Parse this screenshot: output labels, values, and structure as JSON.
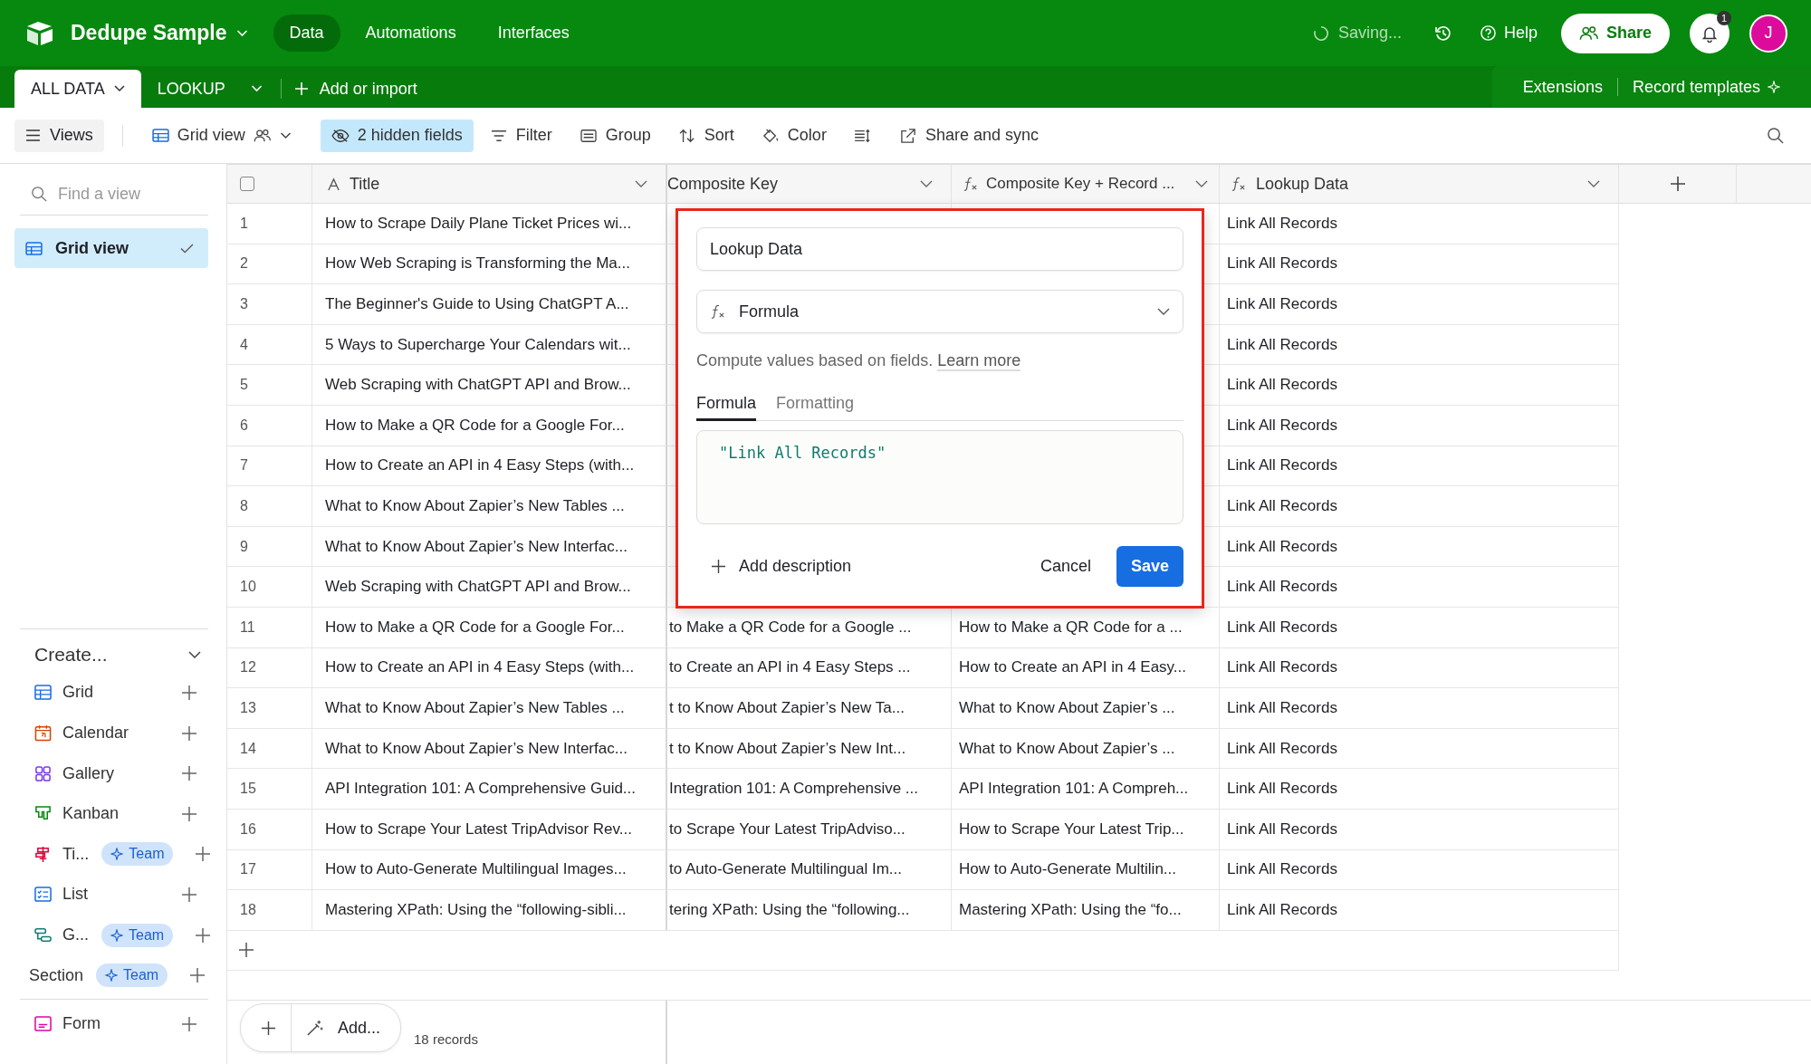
{
  "header": {
    "base_name": "Dedupe Sample",
    "nav": [
      {
        "label": "Data",
        "selected": true
      },
      {
        "label": "Automations",
        "selected": false
      },
      {
        "label": "Interfaces",
        "selected": false
      }
    ],
    "status": "Saving...",
    "help": "Help",
    "share": "Share",
    "notification_count": "1",
    "avatar": "J"
  },
  "table_tabs": [
    {
      "label": "ALL DATA",
      "selected": true
    },
    {
      "label": "LOOKUP",
      "selected": false
    }
  ],
  "add_or_import": "Add or import",
  "extensions": "Extensions",
  "record_templates": "Record templates",
  "toolbar": {
    "views": "Views",
    "view_name": "Grid view",
    "items": [
      {
        "kind": "hidden",
        "label": "2 hidden fields",
        "highlighted": true
      },
      {
        "kind": "filter",
        "label": "Filter",
        "highlighted": false
      },
      {
        "kind": "group",
        "label": "Group",
        "highlighted": false
      },
      {
        "kind": "sort",
        "label": "Sort",
        "highlighted": false
      },
      {
        "kind": "color",
        "label": "Color",
        "highlighted": false
      },
      {
        "kind": "row_height",
        "highlighted": false
      },
      {
        "kind": "share",
        "label": "Share and sync",
        "highlighted": false
      }
    ]
  },
  "sidebar": {
    "search_placeholder": "Find a view",
    "views": [
      {
        "label": "Grid view",
        "selected": true
      }
    ],
    "create_title": "Create...",
    "create_items": [
      {
        "kind": "grid",
        "label": "Grid"
      },
      {
        "kind": "calendar",
        "label": "Calendar"
      },
      {
        "kind": "gallery",
        "label": "Gallery"
      },
      {
        "kind": "kanban",
        "label": "Kanban"
      },
      {
        "kind": "timeline",
        "label": "Ti...",
        "badge": "Team"
      },
      {
        "kind": "list",
        "label": "List"
      },
      {
        "kind": "gantt",
        "label": "G...",
        "badge": "Team"
      },
      {
        "kind": "section",
        "label": "Section",
        "badge": "Team"
      }
    ],
    "bottom_items": [
      {
        "kind": "form",
        "label": "Form"
      }
    ]
  },
  "table": {
    "select_all_checked": false,
    "columns": [
      {
        "kind": "text",
        "label": "Title"
      },
      {
        "kind": "hidden_icon",
        "label": "Composite Key"
      },
      {
        "kind": "formula",
        "label": "Composite Key + Record ..."
      },
      {
        "kind": "formula",
        "label": "Lookup Data"
      }
    ],
    "rows": [
      {
        "number": "1",
        "cells": [
          "How to Scrape Daily Plane Ticket Prices wi...",
          null,
          null,
          "Link All Records"
        ]
      },
      {
        "number": "2",
        "cells": [
          "How Web Scraping is Transforming the Ma...",
          null,
          null,
          "Link All Records"
        ]
      },
      {
        "number": "3",
        "cells": [
          "The Beginner's Guide to Using ChatGPT A...",
          null,
          null,
          "Link All Records"
        ]
      },
      {
        "number": "4",
        "cells": [
          "5 Ways to Supercharge Your Calendars wit...",
          null,
          null,
          "Link All Records"
        ]
      },
      {
        "number": "5",
        "cells": [
          "Web Scraping with ChatGPT API and Brow...",
          null,
          null,
          "Link All Records"
        ]
      },
      {
        "number": "6",
        "cells": [
          "How to Make a QR Code for a Google For...",
          null,
          null,
          "Link All Records"
        ]
      },
      {
        "number": "7",
        "cells": [
          "How to Create an API in 4 Easy Steps (with...",
          null,
          null,
          "Link All Records"
        ]
      },
      {
        "number": "8",
        "cells": [
          "What to Know About Zapier’s New Tables ...",
          null,
          null,
          "Link All Records"
        ]
      },
      {
        "number": "9",
        "cells": [
          "What to Know About Zapier’s New Interfac...",
          null,
          null,
          "Link All Records"
        ]
      },
      {
        "number": "10",
        "cells": [
          "Web Scraping with ChatGPT API and Brow...",
          null,
          null,
          "Link All Records"
        ]
      },
      {
        "number": "11",
        "cells": [
          "How to Make a QR Code for a Google For...",
          "to Make a QR Code for a Google ...",
          "How to Make a QR Code for a ...",
          "Link All Records"
        ]
      },
      {
        "number": "12",
        "cells": [
          "How to Create an API in 4 Easy Steps (with...",
          "to Create an API in 4 Easy Steps ...",
          "How to Create an API in 4 Easy...",
          "Link All Records"
        ]
      },
      {
        "number": "13",
        "cells": [
          "What to Know About Zapier’s New Tables ...",
          "t to Know About Zapier’s New Ta...",
          "What to Know About Zapier’s ...",
          "Link All Records"
        ]
      },
      {
        "number": "14",
        "cells": [
          "What to Know About Zapier’s New Interfac...",
          "t to Know About Zapier’s New Int...",
          "What to Know About Zapier’s ...",
          "Link All Records"
        ]
      },
      {
        "number": "15",
        "cells": [
          "API Integration 101: A Comprehensive Guid...",
          "Integration 101: A Comprehensive ...",
          "API Integration 101: A Compreh...",
          "Link All Records"
        ]
      },
      {
        "number": "16",
        "cells": [
          "How to Scrape Your Latest TripAdvisor Rev...",
          "to Scrape Your Latest TripAdviso...",
          "How to Scrape Your Latest Trip...",
          "Link All Records"
        ]
      },
      {
        "number": "17",
        "cells": [
          "How to Auto-Generate Multilingual Images...",
          "to Auto-Generate Multilingual Im...",
          "How to Auto-Generate Multilin...",
          "Link All Records"
        ]
      },
      {
        "number": "18",
        "cells": [
          "Mastering XPath: Using the “following-sibli...",
          "tering XPath: Using the “following...",
          "Mastering XPath: Using the “fo...",
          "Link All Records"
        ]
      }
    ]
  },
  "footer": {
    "add_label": "Add...",
    "record_count": "18 records"
  },
  "field_editor": {
    "field_name": "Lookup Data",
    "field_type": "Formula",
    "description": "Compute values based on fields.",
    "learn_more": "Learn more",
    "tabs": [
      {
        "label": "Formula",
        "selected": true
      },
      {
        "label": "Formatting",
        "selected": false
      }
    ],
    "formula": "\"Link All Records\"",
    "add_description": "Add description",
    "cancel": "Cancel",
    "save": "Save"
  }
}
